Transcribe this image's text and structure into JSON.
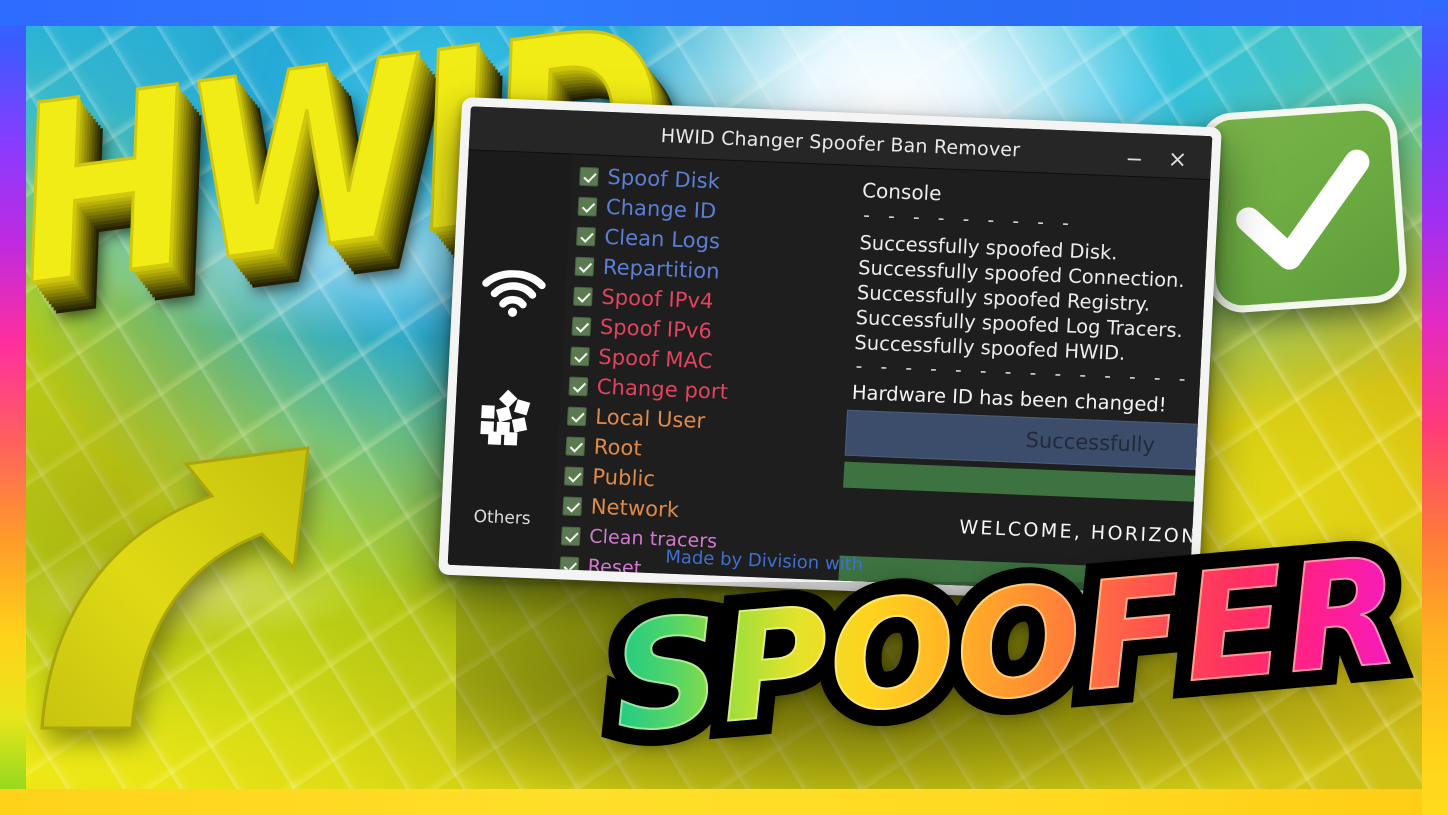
{
  "window": {
    "title": "HWID Changer Spoofer Ban Remover",
    "minimize_label": "−",
    "close_label": "×"
  },
  "rail": {
    "wifi_icon": "wifi-icon",
    "apps_icon": "apps-scatter-icon",
    "label": "Others"
  },
  "options": [
    {
      "label": "Spoof Disk",
      "checked": true,
      "group": "blue"
    },
    {
      "label": "Change ID",
      "checked": true,
      "group": "blue"
    },
    {
      "label": "Clean Logs",
      "checked": true,
      "group": "blue"
    },
    {
      "label": "Repartition",
      "checked": true,
      "group": "blue"
    },
    {
      "label": "Spoof IPv4",
      "checked": true,
      "group": "red"
    },
    {
      "label": "Spoof IPv6",
      "checked": true,
      "group": "red"
    },
    {
      "label": "Spoof MAC",
      "checked": true,
      "group": "red"
    },
    {
      "label": "Change port",
      "checked": true,
      "group": "red"
    },
    {
      "label": "Local User",
      "checked": true,
      "group": "orange"
    },
    {
      "label": "Root",
      "checked": true,
      "group": "orange"
    },
    {
      "label": "Public",
      "checked": true,
      "group": "orange"
    },
    {
      "label": "Network",
      "checked": true,
      "group": "orange"
    },
    {
      "label": "Clean tracers",
      "checked": true,
      "group": "pink"
    },
    {
      "label": "Reset",
      "checked": true,
      "group": "pink"
    }
  ],
  "console": {
    "heading": "Console",
    "divider_top": "- - - - - - - - -",
    "lines": [
      "Successfully spoofed Disk.",
      "Successfully spoofed Connection.",
      "Successfully spoofed Registry.",
      "Successfully spoofed Log Tracers.",
      "Successfully spoofed HWID."
    ],
    "divider_bottom": "- - - - - - - - - - - - - - - - - - - -",
    "status": "Hardware ID has been changed!",
    "success_button": "Successfully",
    "welcome": "WELCOME, HORIZONE",
    "made_by": "Made by Division with"
  },
  "overlay": {
    "hwid_text": "HWID",
    "spoofer_text": "SPOOFER",
    "check_badge_icon": "check-badge-icon",
    "arrow_icon": "curved-arrow-up-right-icon"
  },
  "colors": {
    "blue_group": "#5c7fd6",
    "red_group": "#e2435f",
    "orange_group": "#e08a4a",
    "pink_group": "#d37ad0",
    "checkbox_fill": "#5b7a52",
    "hwid_yellow": "#f2ec16",
    "badge_green": "#6fae43",
    "success_button": "#3b4d6b",
    "progress_green": "#3d7340",
    "window_chrome": "#262626",
    "window_body": "#1e1e1e"
  }
}
